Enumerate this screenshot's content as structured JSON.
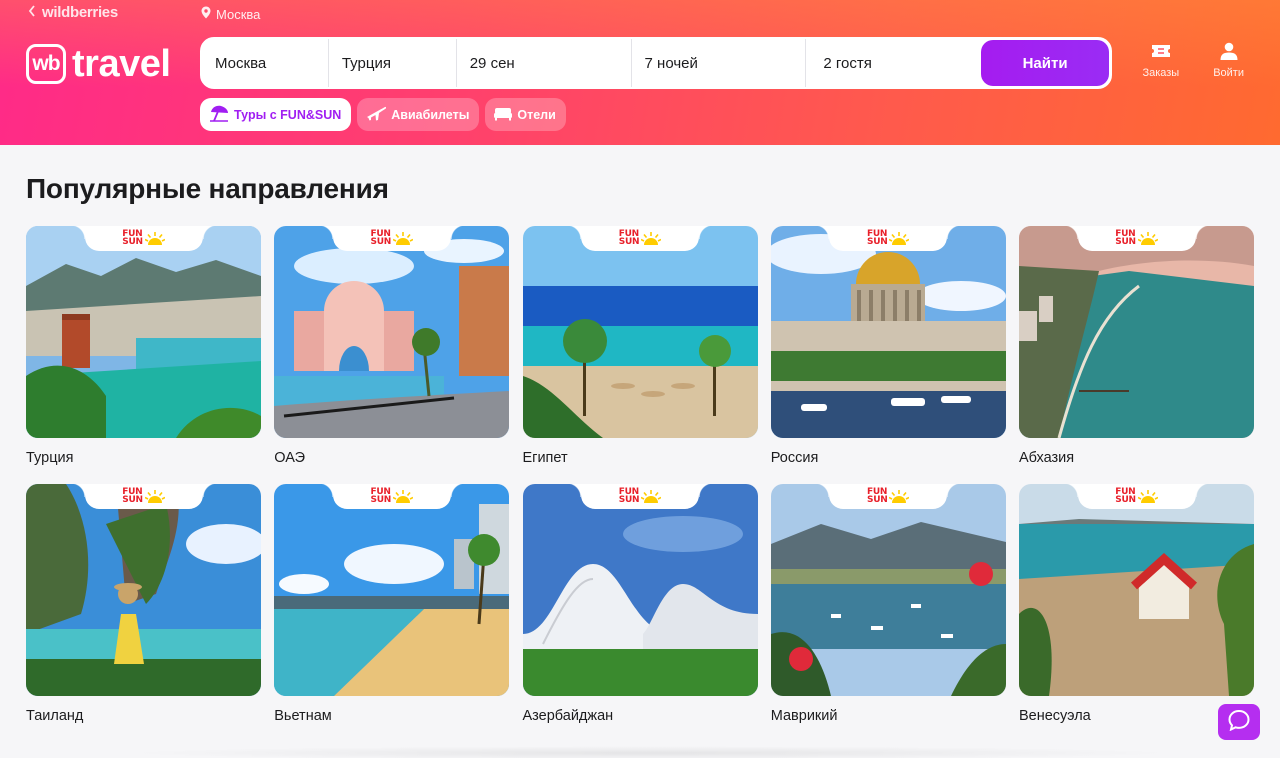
{
  "header": {
    "back_link": "wildberries",
    "geo": "Москва",
    "logo": {
      "wb": "wb",
      "travel": "travel"
    },
    "search": {
      "from": "Москва",
      "to": "Турция",
      "date": "29 сен",
      "nights": "7 ночей",
      "guests": "2 гостя",
      "submit": "Найти"
    },
    "actions": [
      {
        "label": "Заказы",
        "icon": "ticket-icon"
      },
      {
        "label": "Войти",
        "icon": "user-icon"
      }
    ],
    "tabs": [
      {
        "label": "Туры с FUN&SUN",
        "icon": "beach-umbrella-icon",
        "active": true
      },
      {
        "label": "Авиабилеты",
        "icon": "airplane-icon",
        "active": false
      },
      {
        "label": "Отели",
        "icon": "bed-icon",
        "active": false
      }
    ]
  },
  "main": {
    "title": "Популярные направления",
    "badge": {
      "line1": "FUN",
      "line2": "SUN"
    },
    "destinations": [
      {
        "name": "Турция",
        "scene": "harbor"
      },
      {
        "name": "ОАЭ",
        "scene": "resort"
      },
      {
        "name": "Египет",
        "scene": "beach"
      },
      {
        "name": "Россия",
        "scene": "cathedral"
      },
      {
        "name": "Абхазия",
        "scene": "coast"
      },
      {
        "name": "Таиланд",
        "scene": "tropic"
      },
      {
        "name": "Вьетнам",
        "scene": "sandbeach"
      },
      {
        "name": "Азербайджан",
        "scene": "modern"
      },
      {
        "name": "Маврикий",
        "scene": "bay"
      },
      {
        "name": "Венесуэла",
        "scene": "island"
      }
    ]
  },
  "colors": {
    "accent": "#a11ef2",
    "brand_red": "#e8202a"
  }
}
